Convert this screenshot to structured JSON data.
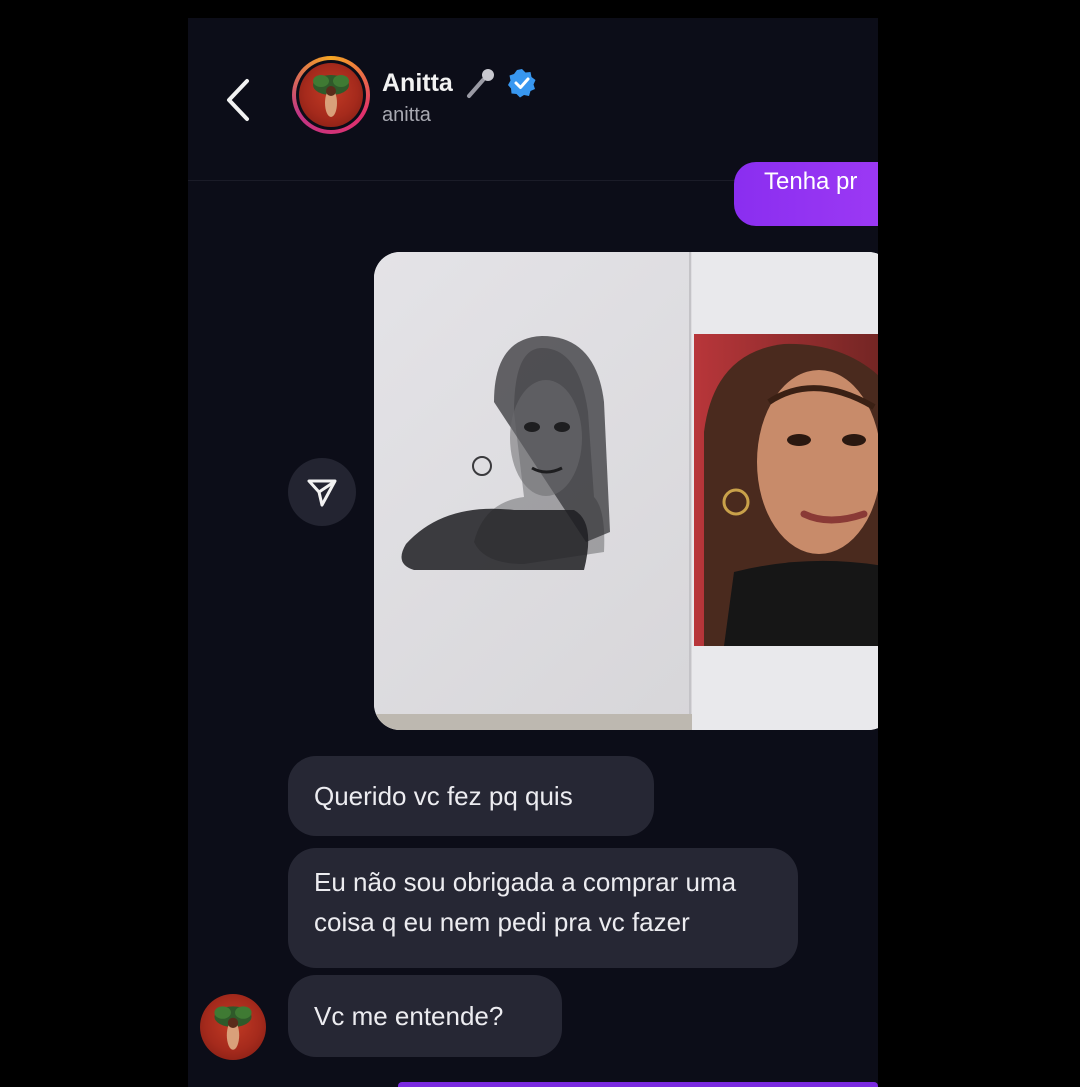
{
  "header": {
    "name": "Anitta",
    "username": "anitta",
    "verified_color": "#3897f0",
    "back_icon": "chevron-left-icon",
    "emoji_icon": "microphone-icon"
  },
  "messages": {
    "sent_partial": "Tenha pr",
    "received": [
      "Querido vc fez pq quis",
      "Eu não sou obrigada a comprar uma coisa q eu nem pedi pra vc fazer",
      "Vc me entende?"
    ]
  },
  "colors": {
    "background": "#0c0d18",
    "sent_bubble": "#9b35f2",
    "received_bubble": "#262734",
    "text": "#ececf0"
  },
  "photo": {
    "description_icon": "shared-photo"
  }
}
